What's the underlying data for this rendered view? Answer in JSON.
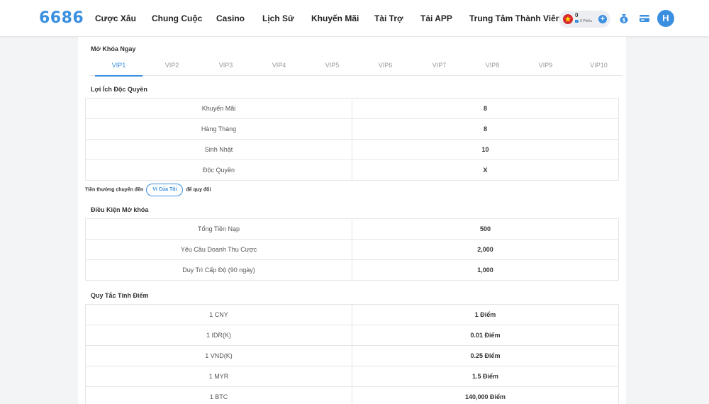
{
  "brand": {
    "logo": "6686"
  },
  "nav": [
    {
      "label": "Cược Xâu"
    },
    {
      "label": "Chung Cuộc"
    },
    {
      "label": "Casino"
    },
    {
      "label": "Lịch Sử"
    },
    {
      "label": "Khuyến Mãi"
    },
    {
      "label": "Tài Trợ"
    },
    {
      "label": "Tải APP"
    },
    {
      "label": "Trung Tâm Thành Viên"
    }
  ],
  "wallet": {
    "balance": "0",
    "tickets": "0 Phiếu",
    "add": "+"
  },
  "user": {
    "avatar_letter": "H"
  },
  "unlock": {
    "title": "Mở Khóa Ngay",
    "tabs": [
      "VIP1",
      "VIP2",
      "VIP3",
      "VIP4",
      "VIP5",
      "VIP6",
      "VIP7",
      "VIP8",
      "VIP9",
      "VIP10"
    ],
    "active_tab": "VIP1"
  },
  "benefits": {
    "title": "Lợi Ích Độc Quyền",
    "rows": [
      {
        "label": "Khuyến Mãi",
        "value": "8"
      },
      {
        "label": "Hàng Tháng",
        "value": "8"
      },
      {
        "label": "Sinh Nhật",
        "value": "10"
      },
      {
        "label": "Độc Quyền",
        "value": "X"
      }
    ]
  },
  "redeem": {
    "prefix": "Tiền thưởng chuyển đến",
    "button": "Ví Của Tôi",
    "suffix": "để quy đổi"
  },
  "conditions": {
    "title": "Điều Kiện Mở khóa",
    "rows": [
      {
        "label": "Tổng Tiền Nạp",
        "value": "500"
      },
      {
        "label": "Yêu Cầu Doanh Thu Cược",
        "value": "2,000"
      },
      {
        "label": "Duy Trì Cấp Độ (90 ngày)",
        "value": "1,000"
      }
    ]
  },
  "points": {
    "title": "Quy Tắc Tính Điểm",
    "rows": [
      {
        "label": "1 CNY",
        "value": "1 Điểm"
      },
      {
        "label": "1 IDR(K)",
        "value": "0.01 Điểm"
      },
      {
        "label": "1 VND(K)",
        "value": "0.25 Điểm"
      },
      {
        "label": "1 MYR",
        "value": "1.5 Điểm"
      },
      {
        "label": "1 BTC",
        "value": "140,000 Điểm"
      }
    ]
  },
  "colors": {
    "accent": "#3a8fe0",
    "flag": "#d8272d",
    "background": "#f3f4f6"
  }
}
